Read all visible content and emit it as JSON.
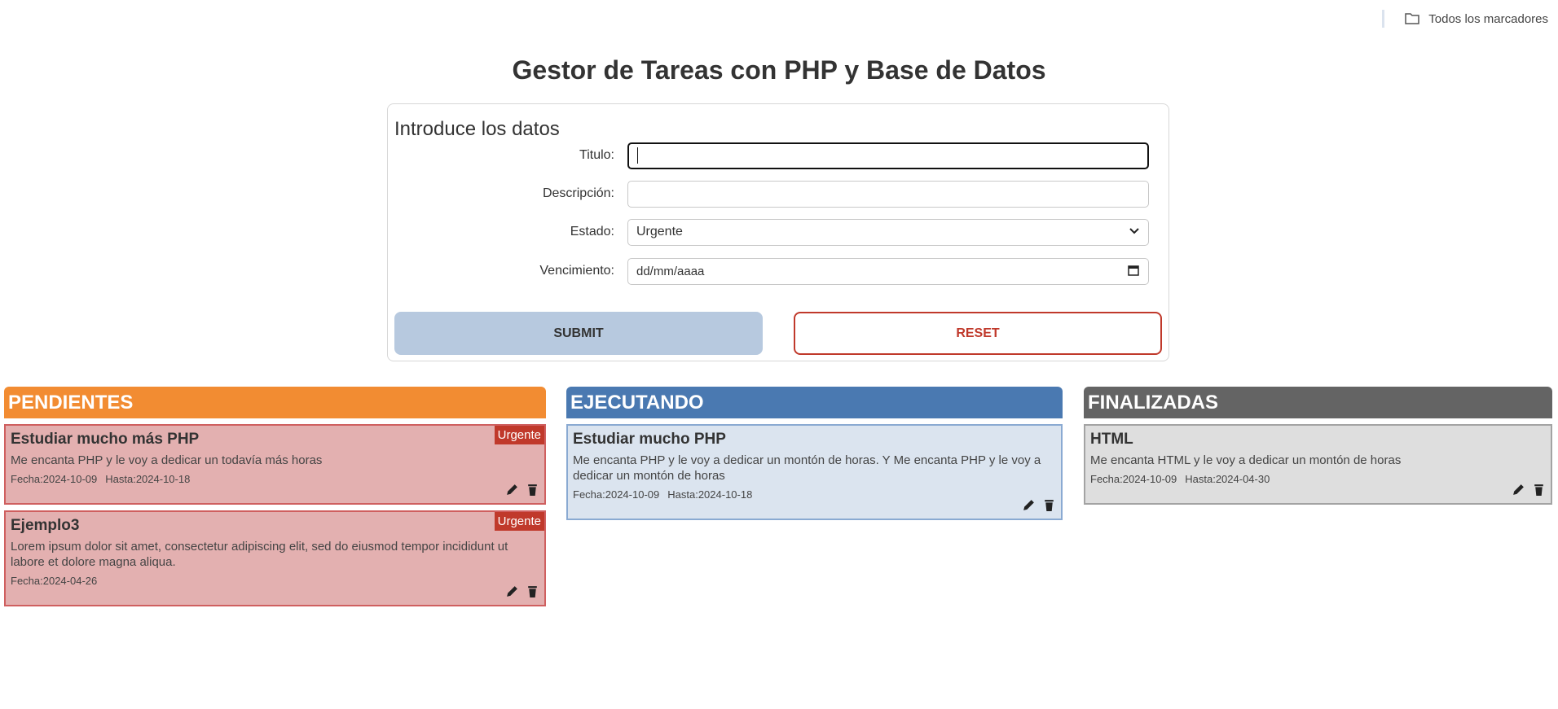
{
  "bookmarks": {
    "label": "Todos los marcadores"
  },
  "page": {
    "title": "Gestor de Tareas con PHP y Base de Datos"
  },
  "form": {
    "heading": "Introduce los datos",
    "titulo_label": "Titulo:",
    "titulo_value": "",
    "descripcion_label": "Descripción:",
    "descripcion_value": "",
    "estado_label": "Estado:",
    "estado_value": "Urgente",
    "vencimiento_label": "Vencimiento:",
    "vencimiento_placeholder": "dd/mm/aaaa",
    "submit_label": "SUBMIT",
    "reset_label": "RESET"
  },
  "colors": {
    "pendientes": "#f28c32",
    "ejecutando": "#4a79b1",
    "finalizadas": "#646464",
    "urgent": "#c0392b"
  },
  "columns": {
    "pendientes": {
      "title": "PENDIENTES",
      "cards": [
        {
          "title": "Estudiar mucho más PHP",
          "badge": "Urgente",
          "description": "Me encanta PHP y le voy a dedicar un todavía más horas",
          "fecha": "Fecha:2024-10-09",
          "hasta": "Hasta:2024-10-18"
        },
        {
          "title": "Ejemplo3",
          "badge": "Urgente",
          "description": "Lorem ipsum dolor sit amet, consectetur adipiscing elit, sed do eiusmod tempor incididunt ut labore et dolore magna aliqua.",
          "fecha": "Fecha:2024-04-26",
          "hasta": ""
        }
      ]
    },
    "ejecutando": {
      "title": "EJECUTANDO",
      "cards": [
        {
          "title": "Estudiar mucho PHP",
          "description": "Me encanta PHP y le voy a dedicar un montón de horas. Y Me encanta PHP y le voy a dedicar un montón de horas",
          "fecha": "Fecha:2024-10-09",
          "hasta": "Hasta:2024-10-18"
        }
      ]
    },
    "finalizadas": {
      "title": "FINALIZADAS",
      "cards": [
        {
          "title": "HTML",
          "description": "Me encanta HTML y le voy a dedicar un montón de horas",
          "fecha": "Fecha:2024-10-09",
          "hasta": "Hasta:2024-04-30"
        }
      ]
    }
  }
}
